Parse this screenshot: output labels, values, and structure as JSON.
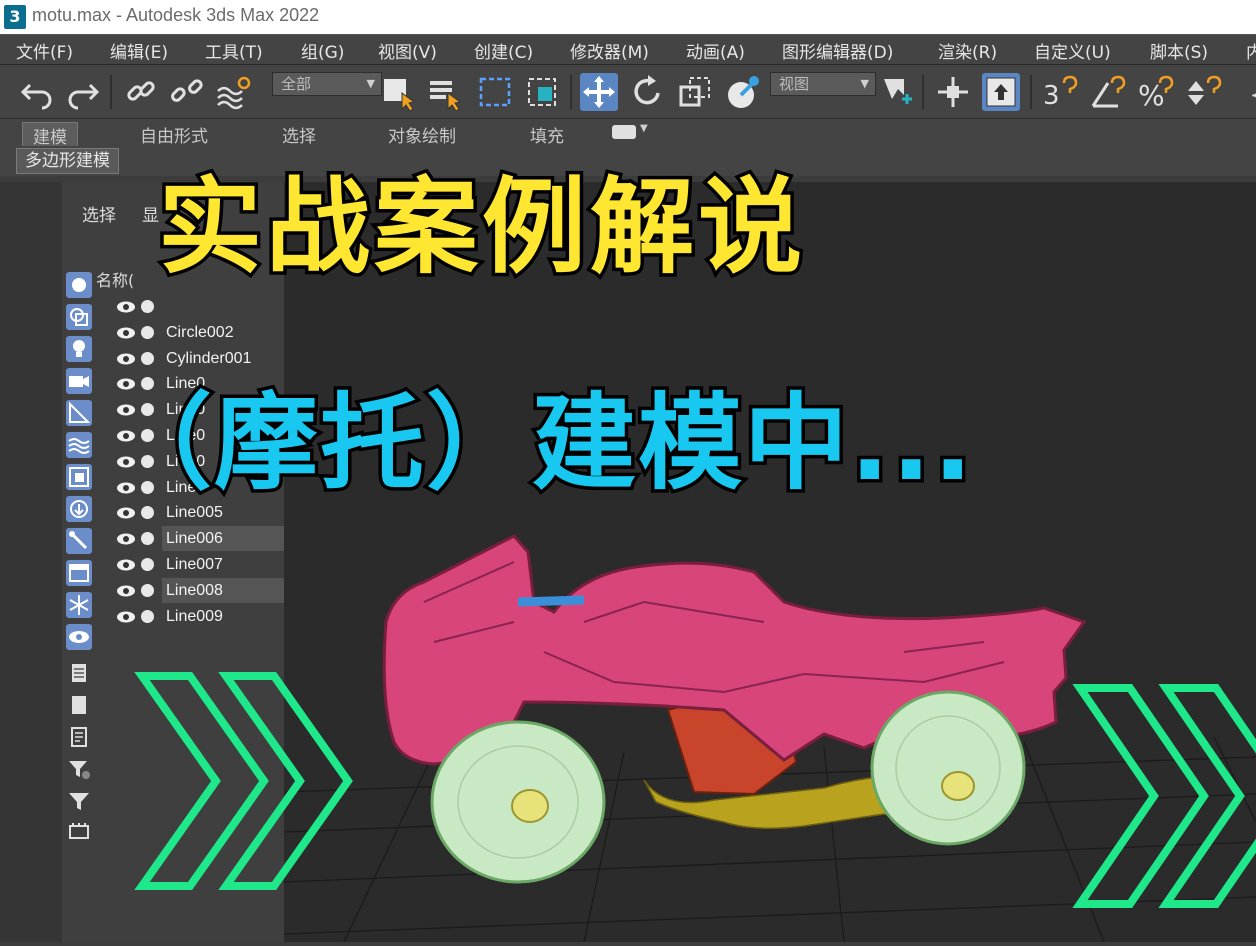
{
  "window": {
    "title": "motu.max - Autodesk 3ds Max 2022",
    "app_icon_label": "3"
  },
  "menu": {
    "items": [
      "文件(F)",
      "编辑(E)",
      "工具(T)",
      "组(G)",
      "视图(V)",
      "创建(C)",
      "修改器(M)",
      "动画(A)",
      "图形编辑器(D)",
      "渲染(R)",
      "自定义(U)",
      "脚本(S)",
      "内"
    ]
  },
  "toolbar": {
    "selection_filter": "全部",
    "reference_coord": "视图",
    "snap_label": "3"
  },
  "ribbon": {
    "tabs": [
      "建模",
      "自由形式",
      "选择",
      "对象绘制",
      "填充"
    ],
    "panel_label": "多边形建模"
  },
  "scene_explorer": {
    "tabs": [
      "选择",
      "显"
    ],
    "column_header": "名称(",
    "rows": [
      {
        "name": ""
      },
      {
        "name": "Circle002"
      },
      {
        "name": "Cylinder001"
      },
      {
        "name": "Line0"
      },
      {
        "name": "Line0"
      },
      {
        "name": "Line0"
      },
      {
        "name": "Line0"
      },
      {
        "name": "Line0"
      },
      {
        "name": "Line005"
      },
      {
        "name": "Line006"
      },
      {
        "name": "Line007"
      },
      {
        "name": "Line008"
      },
      {
        "name": "Line009"
      }
    ]
  },
  "overlay": {
    "line1": "实战案例解说",
    "line2": "（摩托）建模中..."
  },
  "colors": {
    "yellow_text": "#ffe630",
    "cyan_text": "#18c8f0",
    "accent_blue": "#5b86c4",
    "chevron_green": "#1ee88a",
    "bike_pink": "#d8457a"
  },
  "icons": [
    "undo-icon",
    "redo-icon",
    "link-icon",
    "unlink-icon",
    "bind-space-warp-icon",
    "select-object-icon",
    "select-by-name-icon",
    "rect-region-icon",
    "window-crossing-icon",
    "move-icon",
    "rotate-icon",
    "scale-icon",
    "select-place-icon",
    "mirror-pivot-icon",
    "snap-icon",
    "angle-snap-icon",
    "percent-snap-icon",
    "spinner-snap-icon"
  ]
}
